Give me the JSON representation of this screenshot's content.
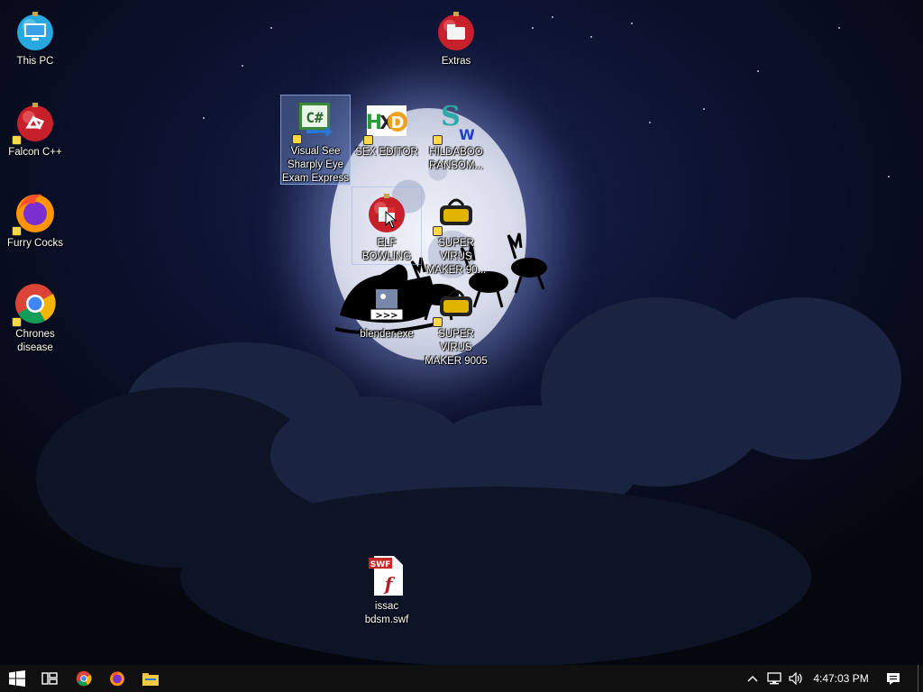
{
  "desktop": {
    "icons": [
      {
        "label": "This PC"
      },
      {
        "label": "Falcon C++"
      },
      {
        "label": "Furry Cocks"
      },
      {
        "label": "Chrones disease"
      },
      {
        "label": "Extras"
      },
      {
        "label": "Visual See Sharply Eye Exam Express"
      },
      {
        "label": "SEX EDITOR"
      },
      {
        "label": "HILDABOO RANSOM..."
      },
      {
        "label": "ELF BOWLING"
      },
      {
        "label": "SUPER VIRUS MAKER 90..."
      },
      {
        "label": "blender.exe"
      },
      {
        "label": "SUPER VIRUS MAKER 9005"
      },
      {
        "label": "issac bdsm.swf"
      }
    ],
    "selected_icon": "Visual See Sharply Eye Exam Express"
  },
  "taskbar": {
    "apps": [
      "start-icon",
      "task-view-icon",
      "chrome-icon",
      "firefox-icon",
      "file-explorer-icon"
    ],
    "tray": [
      "show-hidden-icons-chevron",
      "network-icon",
      "volume-icon"
    ],
    "clock": "4:47:03 PM",
    "notification": "action-center-icon"
  },
  "colors": {
    "taskbar": "#101010",
    "sky": "#0c1230",
    "moon": "#e4e7f2"
  }
}
